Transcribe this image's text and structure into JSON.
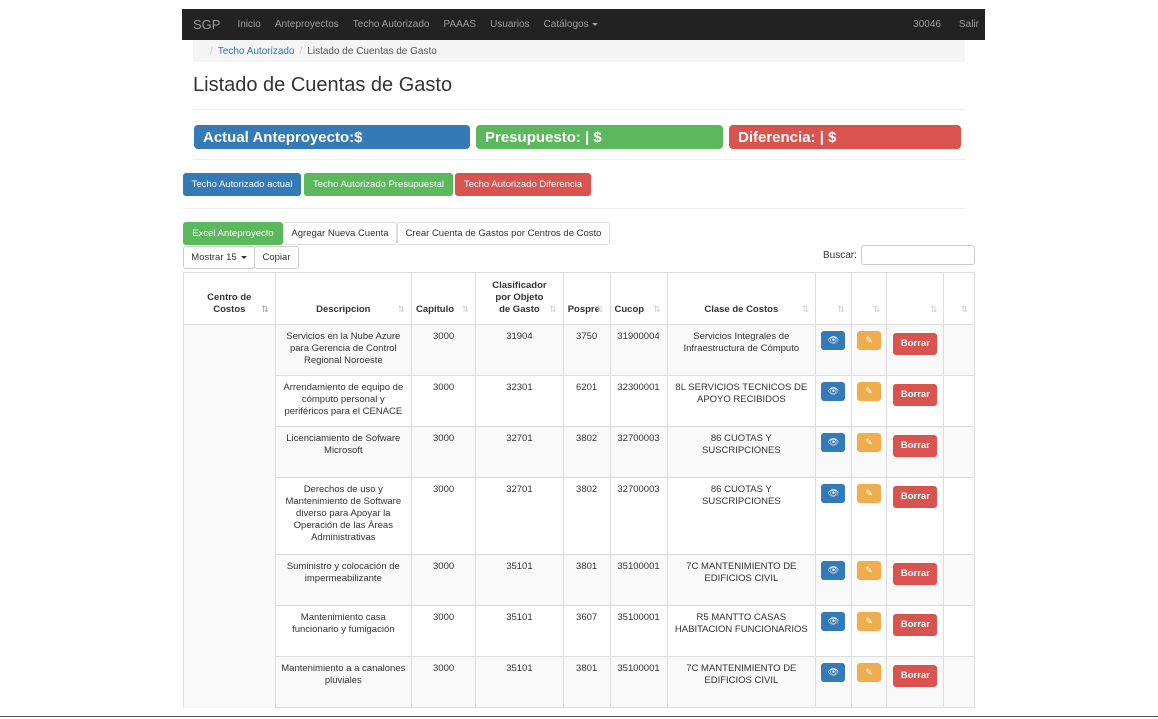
{
  "navbar": {
    "brand": "SGP",
    "items": [
      "Inicio",
      "Anteproyectos",
      "Techo Autorizado",
      "PAAAS",
      "Usuarios",
      "Catálogos"
    ],
    "user": "30046",
    "logout": "Salir"
  },
  "breadcrumb": {
    "sep": "/",
    "link": "Techo Autorizado",
    "active": "Listado de Cuentas de Gasto"
  },
  "page_title": "Listado de Cuentas de Gasto",
  "summary": {
    "actual": "Actual Anteproyecto:$",
    "presupuesto": "Presupuesto: |  $",
    "diferencia": "Diferencia:    | $"
  },
  "tabs": {
    "actual": "Techo Autorizado actual",
    "presupuestal": "Techo Autorizado Presupuestal",
    "diferencia": "Techo Autorizado Diferencia"
  },
  "toolbar": {
    "excel": "Excel Anteproyecto",
    "agregar": "Agregar Nueva Cuenta",
    "crear": "Crear Cuenta de Gastos por Centros de Costo",
    "mostrar": "Mostrar 15",
    "copiar": "Copiar",
    "buscar": "Buscar:"
  },
  "colors": {
    "primary": "#337ab7",
    "success": "#5cb85c",
    "danger": "#d9534f",
    "warning": "#f0ad4e"
  },
  "table": {
    "headers": {
      "centro_line1": "Centro de",
      "centro_line2": "Costos",
      "descripcion": "Descripcion",
      "capitulo": "Capitulo",
      "clasif_line1": "Clasificador",
      "clasif_line2": "por Objeto",
      "clasif_line3": "de Gasto",
      "pospre": "Pospre",
      "cucop": "Cucop",
      "clase": "Clase de Costos"
    },
    "action_labels": {
      "view_icon": "👁",
      "edit_icon": "✎",
      "delete": "Borrar"
    },
    "rows": [
      {
        "descripcion": "Servicios en la Nube Azure para Gerencia de Control Regional Noroeste",
        "capitulo": "3000",
        "clasificador": "31904",
        "pospre": "3750",
        "cucop": "31900004",
        "clase": "Servicios Integrales de Infraestructura de Cómputo"
      },
      {
        "descripcion": "Arrendamiento de equipo de cómputo personal y periféricos para el CENACE",
        "capitulo": "3000",
        "clasificador": "32301",
        "pospre": "6201",
        "cucop": "32300001",
        "clase": "8L SERVICIOS TECNICOS DE APOYO RECIBIDOS"
      },
      {
        "descripcion": "Licenciamiento de Sofware Microsoft",
        "capitulo": "3000",
        "clasificador": "32701",
        "pospre": "3802",
        "cucop": "32700003",
        "clase": "86 CUOTAS Y SUSCRIPCIONES"
      },
      {
        "descripcion": "Derechos de uso y Mantenimiento de Software diverso para Apoyar la Operación de las Áreas Administrativas",
        "capitulo": "3000",
        "clasificador": "32701",
        "pospre": "3802",
        "cucop": "32700003",
        "clase": "86 CUOTAS Y SUSCRIPCIONES"
      },
      {
        "descripcion": "Suministro y colocación de impermeabilizante",
        "capitulo": "3000",
        "clasificador": "35101",
        "pospre": "3801",
        "cucop": "35100001",
        "clase": "7C MANTENIMIENTO DE EDIFICIOS CIVIL"
      },
      {
        "descripcion": "Mantenimiento casa funcionario y fumigación",
        "capitulo": "3000",
        "clasificador": "35101",
        "pospre": "3607",
        "cucop": "35100001",
        "clase": "R5 MANTTO CASAS HABITACION FUNCIONARIOS"
      },
      {
        "descripcion": "Mantenimiento a a canalones pluviales",
        "capitulo": "3000",
        "clasificador": "35101",
        "pospre": "3801",
        "cucop": "35100001",
        "clase": "7C MANTENIMIENTO DE EDIFICIOS CIVIL"
      }
    ]
  }
}
